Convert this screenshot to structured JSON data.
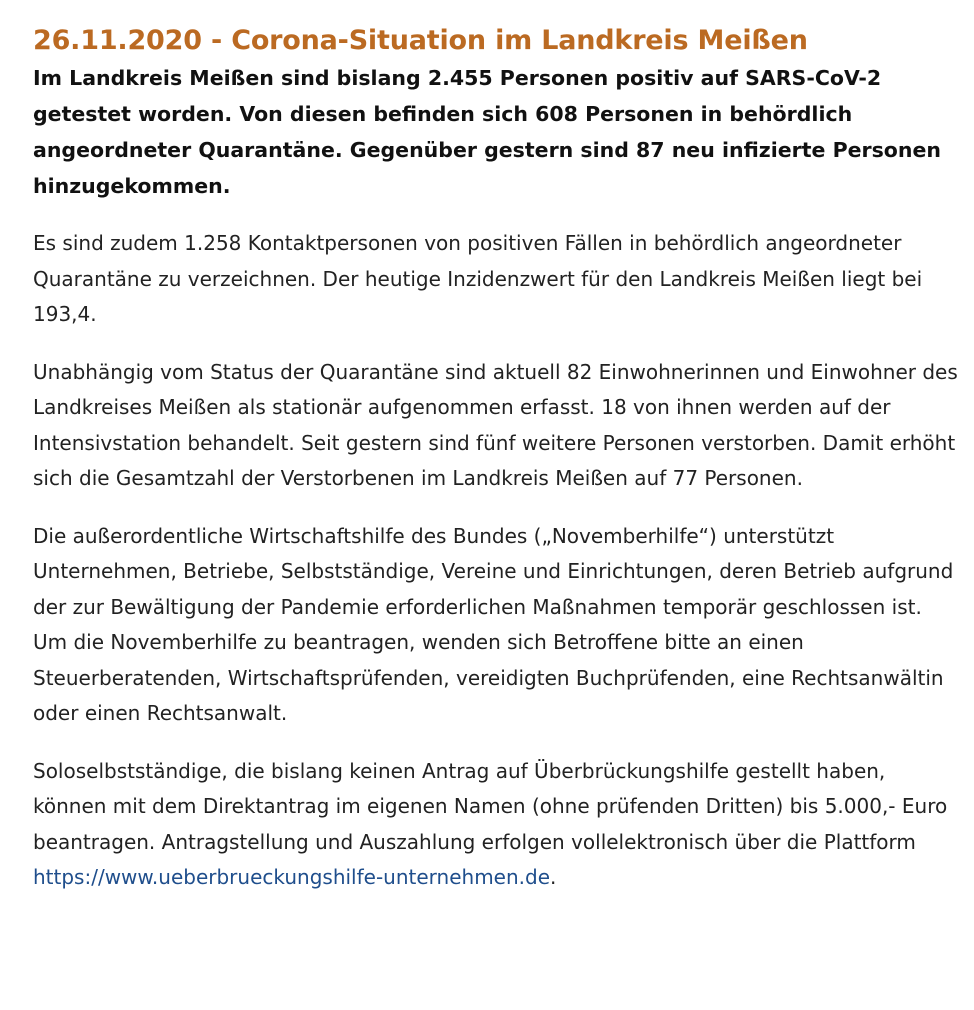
{
  "article": {
    "headline": "26.11.2020 - Corona-Situation im Landkreis Meißen",
    "lead": "Im Landkreis Meißen sind bislang 2.455 Personen positiv auf SARS-CoV-2 getestet worden. Von diesen befinden sich 608 Personen in behördlich angeordneter Quarantäne. Gegenüber gestern sind 87 neu infizierte Personen hinzugekommen.",
    "paragraphs": [
      "Es sind zudem 1.258 Kontaktpersonen von positiven Fällen in behördlich angeordneter Quarantäne zu verzeichnen. Der heutige Inzidenzwert für den Landkreis Meißen liegt bei 193,4.",
      "Unabhängig vom Status der Quarantäne sind aktuell 82 Einwohnerinnen und Einwohner des Landkreises Meißen als stationär aufgenommen erfasst. 18 von ihnen werden auf der Intensivstation behandelt. Seit gestern sind fünf weitere Personen verstorben. Damit erhöht sich die Gesamtzahl der Verstorbenen im Landkreis Meißen auf 77 Personen.",
      "Die außerordentliche Wirtschaftshilfe des Bundes („Novemberhilfe“) unterstützt Unternehmen, Betriebe, Selbstständige, Vereine und Einrichtungen, deren Betrieb aufgrund der zur Bewältigung der Pandemie erforderlichen Maßnahmen temporär geschlossen ist. Um die Novemberhilfe zu beantragen, wenden sich Betroffene bitte an einen Steuerberatenden, Wirtschaftsprüfenden, vereidigten Buchprüfenden, eine Rechtsanwältin oder einen Rechtsanwalt."
    ],
    "last_paragraph_text": "Soloselbstständige, die bislang keinen Antrag auf Überbrückungshilfe gestellt haben, können mit dem Direktantrag im eigenen Namen (ohne prüfenden Dritten) bis 5.000,- Euro beantragen. Antragstellung und Auszahlung erfolgen vollelektronisch über die Plattform ",
    "link_text": "https://www.ueberbrueckungshilfe-unternehmen.de",
    "link_suffix": ".",
    "colors": {
      "headline": "#bb6a22",
      "link": "#1f4e8c"
    }
  }
}
